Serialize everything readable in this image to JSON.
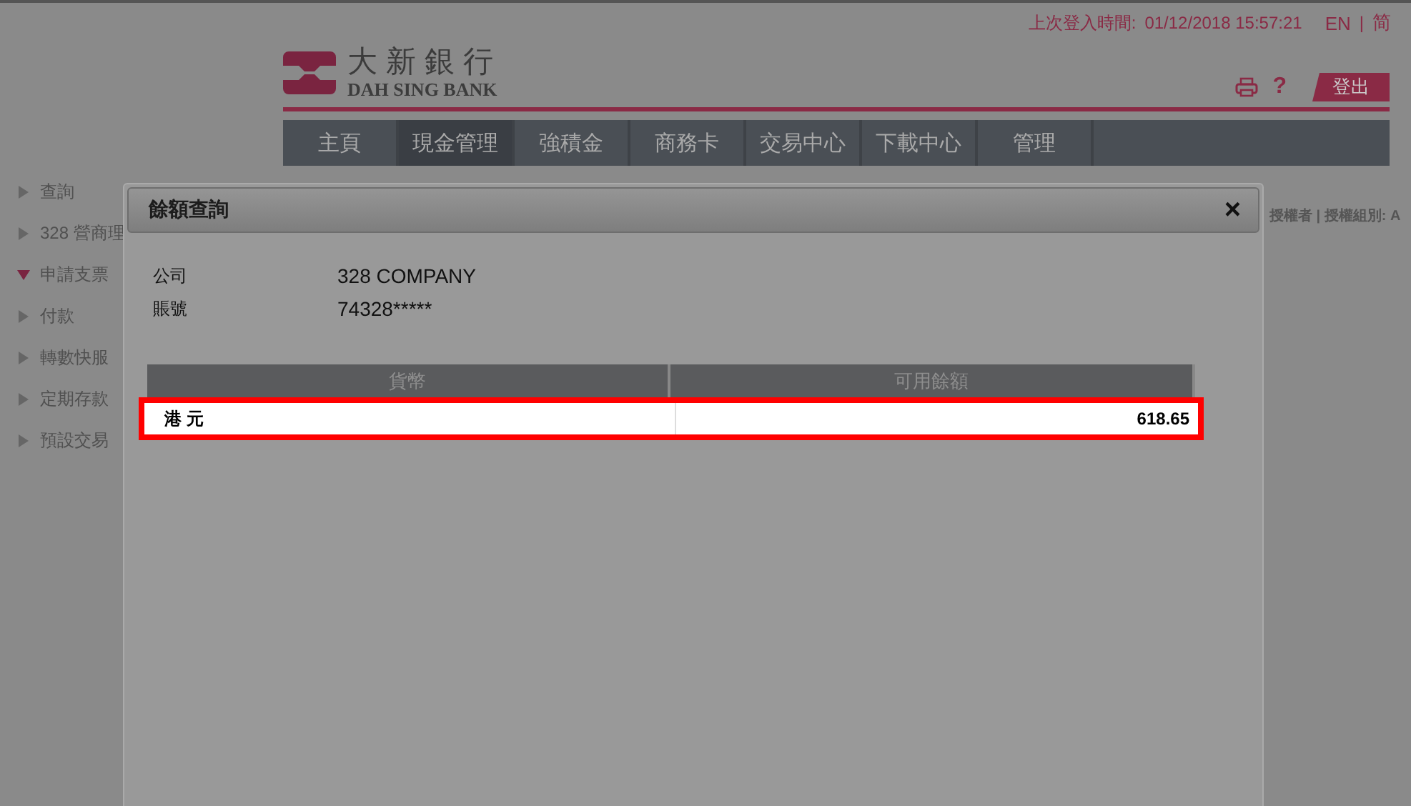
{
  "header": {
    "last_login_label": "上次登入時間:",
    "last_login_time": "01/12/2018 15:57:21",
    "languages": [
      {
        "label": "EN",
        "selected": false
      },
      {
        "label": "简",
        "selected": false
      }
    ],
    "language_separator": "|",
    "logo": {
      "chinese": "大新銀行",
      "english": "DAH SING BANK"
    },
    "help": "?",
    "logout": "登出"
  },
  "nav": [
    {
      "label": "主頁",
      "selected": false
    },
    {
      "label": "現金管理",
      "selected": true
    },
    {
      "label": "強積金",
      "selected": false
    },
    {
      "label": "商務卡",
      "selected": false
    },
    {
      "label": "交易中心",
      "selected": false
    },
    {
      "label": "下載中心",
      "selected": false
    },
    {
      "label": "管理",
      "selected": false
    }
  ],
  "sidebar": [
    {
      "label": "查詢",
      "expanded": false
    },
    {
      "label": "328 營商理",
      "expanded": false
    },
    {
      "label": "申請支票",
      "expanded": true
    },
    {
      "label": "付款",
      "expanded": false
    },
    {
      "label": "轉數快服",
      "expanded": false
    },
    {
      "label": "定期存款",
      "expanded": false
    },
    {
      "label": "預設交易",
      "expanded": false
    }
  ],
  "user_info": "授權者 | 授權組別: A",
  "dialog": {
    "title": "餘額查詢",
    "close": "×",
    "fields": [
      {
        "label": "公司",
        "value": "328 COMPANY"
      },
      {
        "label": "賬號",
        "value": "74328*****"
      }
    ],
    "table": {
      "columns": [
        "貨幣",
        "可用餘額"
      ],
      "rows": [
        {
          "currency": "港 元",
          "balance": "618.65",
          "highlighted": true
        }
      ]
    }
  }
}
